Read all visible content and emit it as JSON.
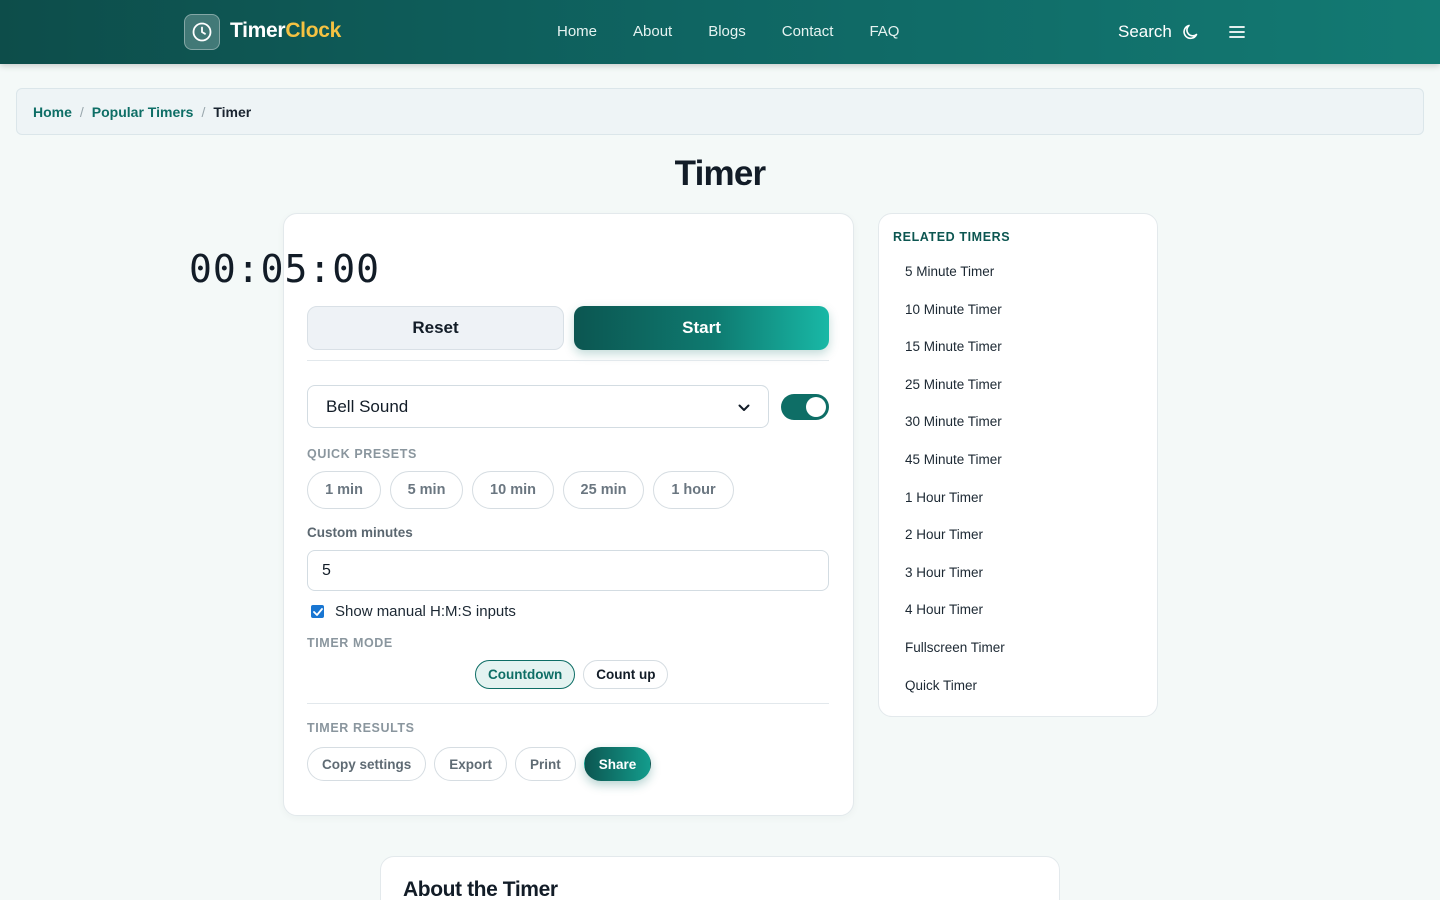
{
  "header": {
    "logo_part1": "Timer",
    "logo_part2": "Clock",
    "nav": [
      "Home",
      "About",
      "Blogs",
      "Contact",
      "FAQ"
    ],
    "search_label": "Search"
  },
  "breadcrumb": {
    "items": [
      "Home",
      "Popular Timers"
    ],
    "current": "Timer"
  },
  "page_title": "Timer",
  "timer": {
    "display": "00:05:00",
    "reset_label": "Reset",
    "start_label": "Start",
    "sound_select": "Bell Sound",
    "sound_enabled": true,
    "quick_presets_label": "QUICK PRESETS",
    "presets": [
      "1 min",
      "5 min",
      "10 min",
      "25 min",
      "1 hour"
    ],
    "custom_label": "Custom minutes",
    "custom_value": "5",
    "manual_label": "Show manual H:M:S inputs",
    "manual_checked": true,
    "mode_label": "TIMER MODE",
    "modes": [
      "Countdown",
      "Count up"
    ],
    "active_mode": "Countdown",
    "results_label": "TIMER RESULTS",
    "results_buttons": [
      "Copy settings",
      "Export",
      "Print",
      "Share"
    ]
  },
  "related": {
    "title": "RELATED TIMERS",
    "items": [
      "5 Minute Timer",
      "10 Minute Timer",
      "15 Minute Timer",
      "25 Minute Timer",
      "30 Minute Timer",
      "45 Minute Timer",
      "1 Hour Timer",
      "2 Hour Timer",
      "3 Hour Timer",
      "4 Hour Timer",
      "Fullscreen Timer",
      "Quick Timer"
    ]
  },
  "about": {
    "title": "About the Timer"
  },
  "colors": {
    "brand": "#0e6e66",
    "accent": "#f5c242",
    "header_start": "#0d4d4a",
    "header_end": "#137a73"
  }
}
